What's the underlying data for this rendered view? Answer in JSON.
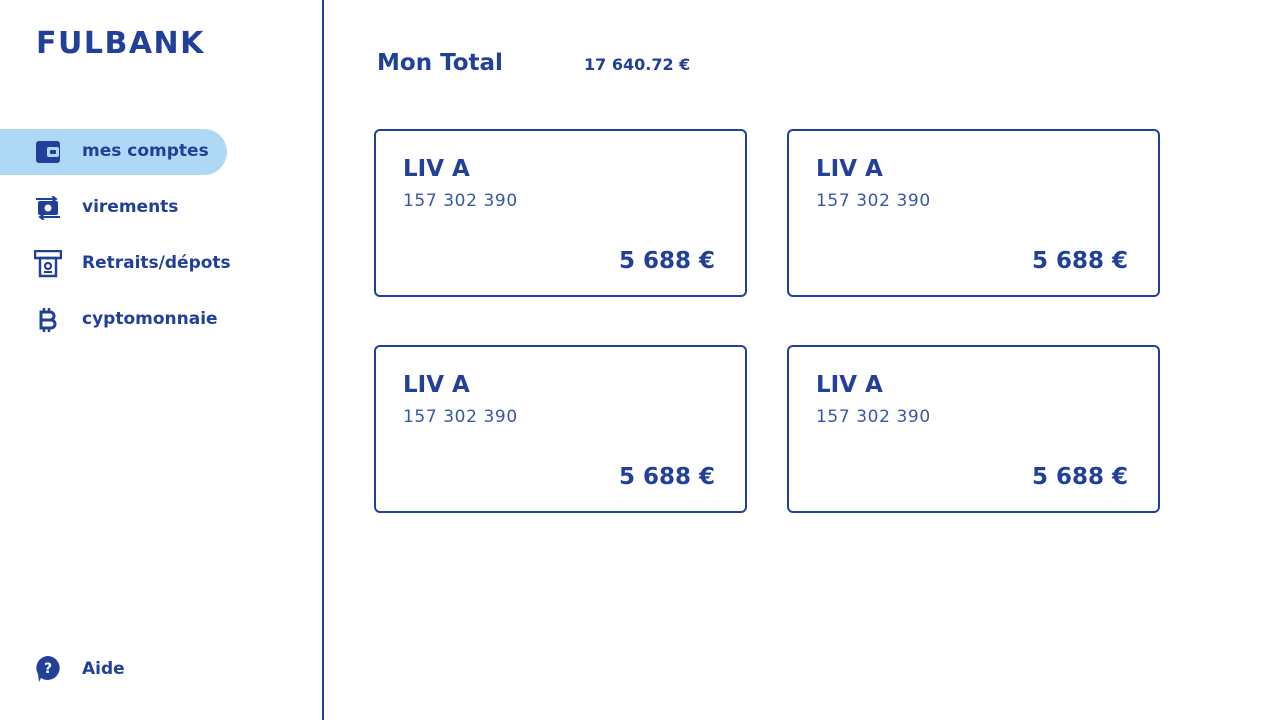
{
  "app": {
    "logo": "FULBANK"
  },
  "sidebar": {
    "items": [
      {
        "label": "mes comptes",
        "icon": "wallet-icon",
        "active": true
      },
      {
        "label": "virements",
        "icon": "transfer-money-icon",
        "active": false
      },
      {
        "label": "Retraits/dépots",
        "icon": "atm-withdraw-icon",
        "active": false
      },
      {
        "label": "cyptomonnaie",
        "icon": "bitcoin-icon",
        "active": false
      }
    ],
    "help": {
      "label": "Aide",
      "icon": "help-bubble-icon"
    }
  },
  "main": {
    "total_label": "Mon Total",
    "total_value": "17 640.72 €",
    "accounts": [
      {
        "name": "LIV A",
        "number": "157 302 390",
        "amount": "5 688 €"
      },
      {
        "name": "LIV A",
        "number": "157 302 390",
        "amount": "5 688 €"
      },
      {
        "name": "LIV A",
        "number": "157 302 390",
        "amount": "5 688 €"
      },
      {
        "name": "LIV A",
        "number": "157 302 390",
        "amount": "5 688 €"
      }
    ]
  },
  "colors": {
    "primary": "#22409a",
    "active_bg": "#aed8f5",
    "background": "#ffffff"
  }
}
